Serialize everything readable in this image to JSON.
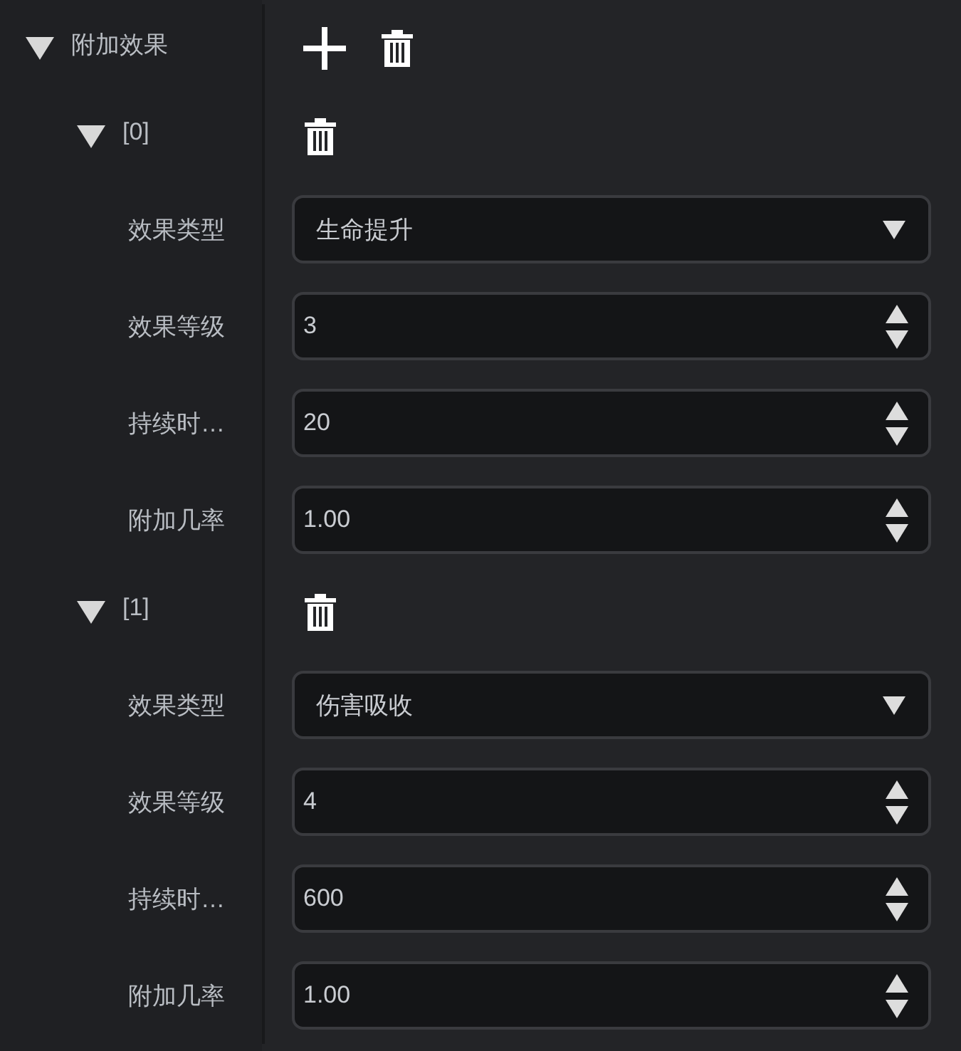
{
  "root": {
    "label": "附加效果",
    "expanded": true,
    "children": [
      {
        "label": "[0]",
        "expanded": true,
        "fields": [
          {
            "label": "效果类型",
            "kind": "select",
            "value": "生命提升"
          },
          {
            "label": "效果等级",
            "kind": "number",
            "value": "3"
          },
          {
            "label": "持续时…",
            "kind": "number",
            "value": "20"
          },
          {
            "label": "附加几率",
            "kind": "number",
            "value": "1.00"
          }
        ]
      },
      {
        "label": "[1]",
        "expanded": true,
        "fields": [
          {
            "label": "效果类型",
            "kind": "select",
            "value": "伤害吸收"
          },
          {
            "label": "效果等级",
            "kind": "number",
            "value": "4"
          },
          {
            "label": "持续时…",
            "kind": "number",
            "value": "600"
          },
          {
            "label": "附加几率",
            "kind": "number",
            "value": "1.00"
          }
        ]
      }
    ]
  }
}
